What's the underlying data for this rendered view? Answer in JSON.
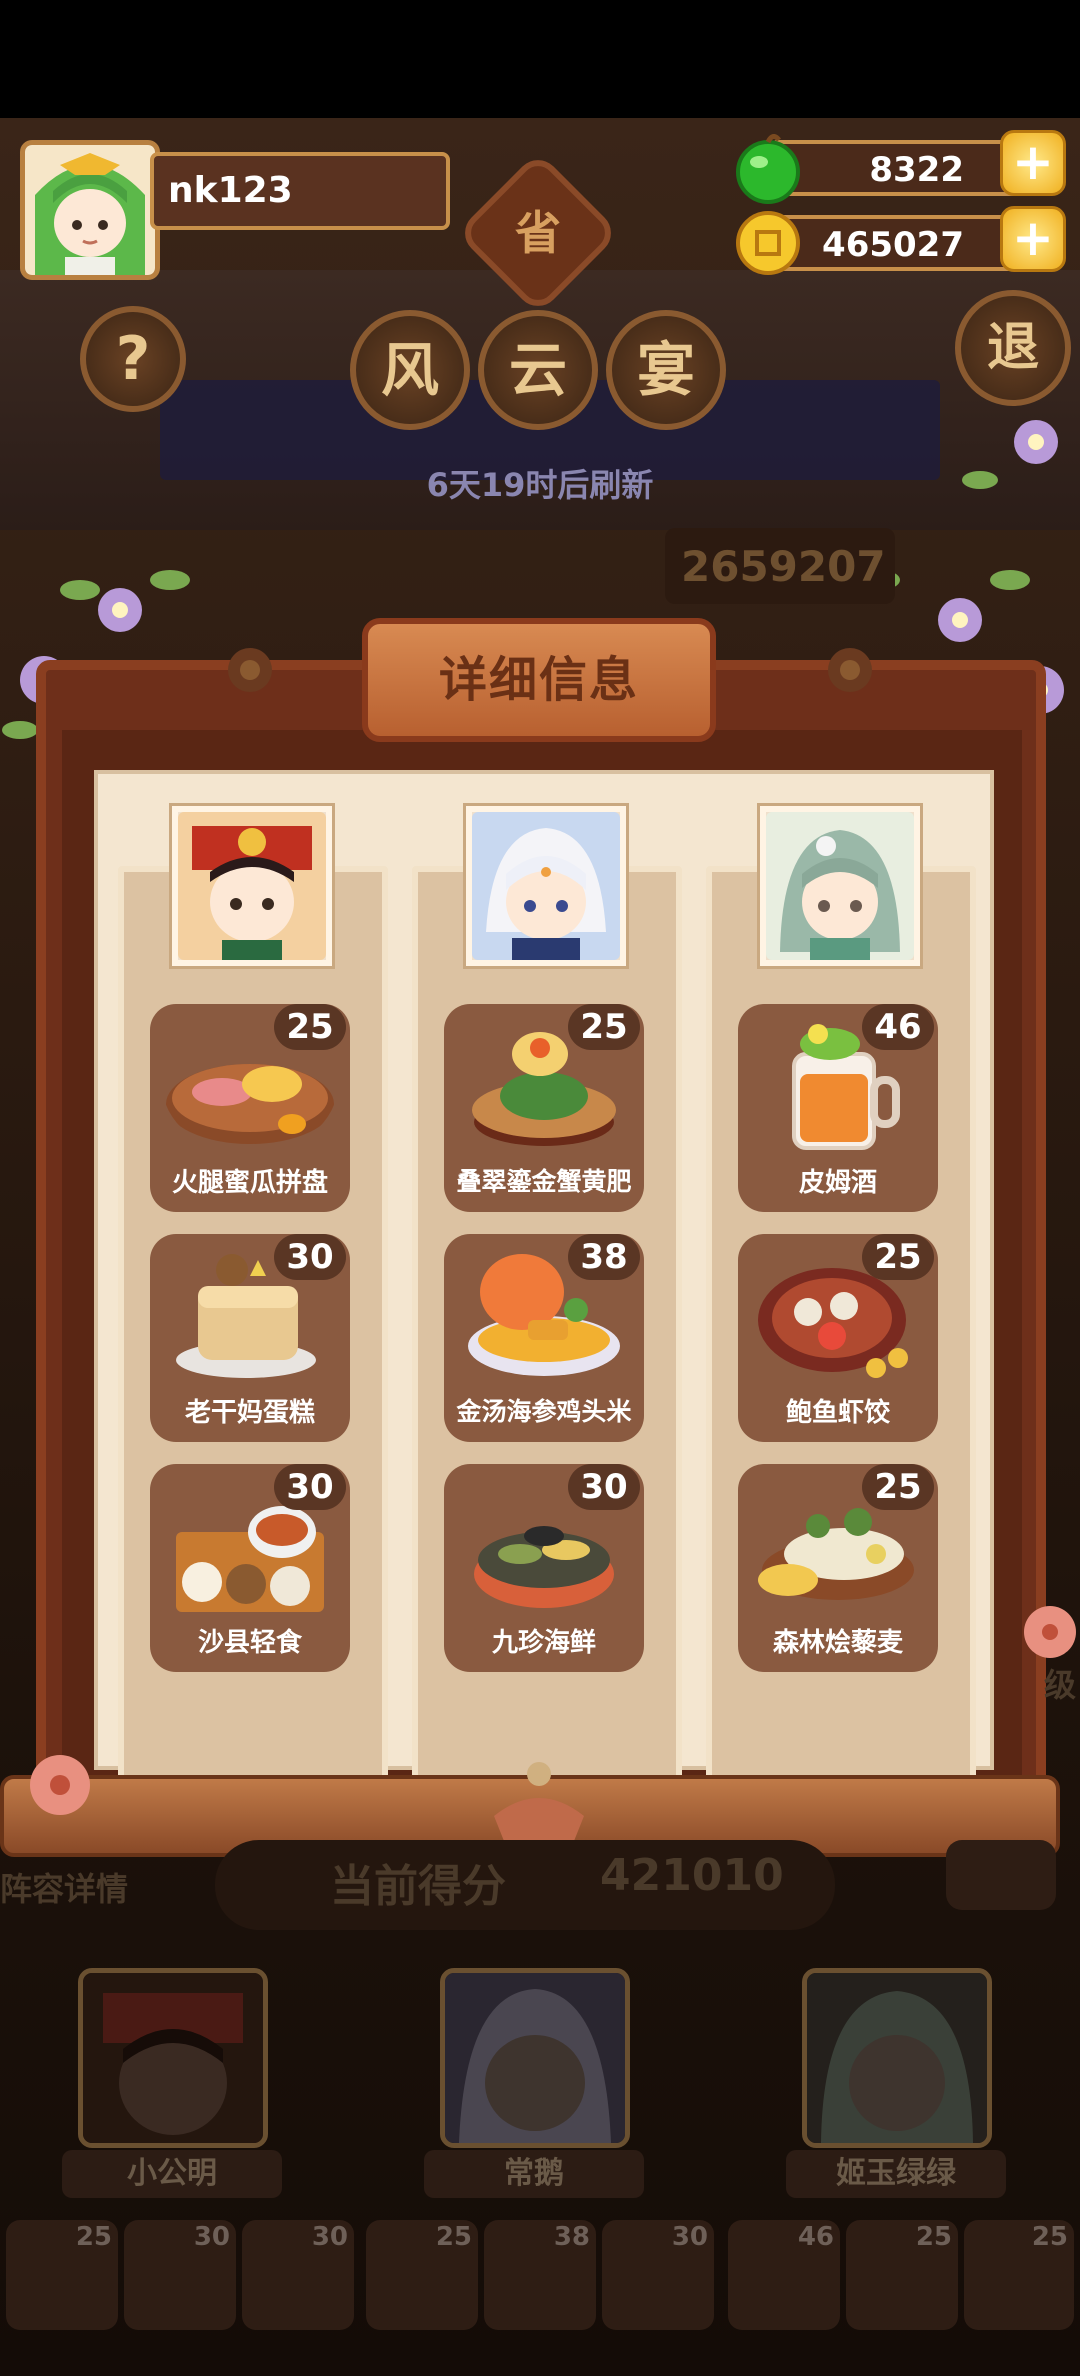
{
  "player": {
    "name": "nk123"
  },
  "currency": {
    "gems": "8322",
    "coins": "465027",
    "plus_symbol": "+"
  },
  "header": {
    "province_badge": "省",
    "help_symbol": "?",
    "title_chars": [
      "风",
      "云",
      "宴"
    ],
    "exit_label": "退",
    "refresh_text": "6天19时后刷新",
    "score_top": "2659207"
  },
  "panel": {
    "title": "详细信息",
    "columns": [
      {
        "dishes": [
          {
            "name": "火腿蜜瓜拼盘",
            "value": "25"
          },
          {
            "name": "老干妈蛋糕",
            "value": "30"
          },
          {
            "name": "沙县轻食",
            "value": "30"
          }
        ]
      },
      {
        "dishes": [
          {
            "name": "叠翠鎏金蟹黄肥",
            "value": "25"
          },
          {
            "name": "金汤海参鸡头米",
            "value": "38"
          },
          {
            "name": "九珍海鲜",
            "value": "30"
          }
        ]
      },
      {
        "dishes": [
          {
            "name": "皮姆酒",
            "value": "46"
          },
          {
            "name": "鲍鱼虾饺",
            "value": "25"
          },
          {
            "name": "森林烩藜麦",
            "value": "25"
          }
        ]
      }
    ]
  },
  "bottom": {
    "lineup_label": "阵容详情",
    "score_label": "当前得分",
    "score_value": "421010",
    "side_label": "级",
    "characters": [
      "小公明",
      "常鹅",
      "姬玉绿绿"
    ],
    "mini_values": [
      "25",
      "30",
      "30",
      "25",
      "38",
      "30",
      "46",
      "25",
      "25"
    ]
  },
  "colors": {
    "accent": "#c8904a",
    "panel": "#6e2f1a",
    "paper": "#f4e6d0",
    "gold": "#f0b020",
    "gem": "#2cb82c"
  }
}
